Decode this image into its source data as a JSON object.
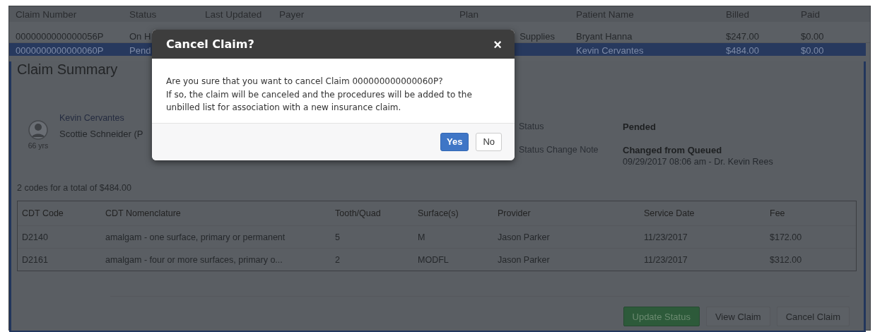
{
  "claims_table": {
    "columns": [
      {
        "label": "Claim Number"
      },
      {
        "label": "Status"
      },
      {
        "label": "Last Updated"
      },
      {
        "label": "Payer"
      },
      {
        "label": "Plan"
      },
      {
        "label": "Patient Name"
      },
      {
        "label": "Billed"
      },
      {
        "label": "Paid"
      }
    ],
    "rows": [
      {
        "claim_number": "0000000000000056P",
        "status": "On H",
        "plan": "Supplies",
        "patient_name": "Bryant Hanna",
        "billed": "$247.00",
        "paid": "$0.00",
        "selected": false
      },
      {
        "claim_number": "0000000000000060P",
        "status": "Pend",
        "patient_name": "Kevin Cervantes",
        "billed": "$484.00",
        "paid": "$0.00",
        "selected": true
      }
    ]
  },
  "claim_summary": {
    "title": "Claim Summary",
    "patient_name": "Kevin Cervantes",
    "subscriber": "Scottie Schneider (P",
    "age": "66 yrs",
    "fields": [
      {
        "label": "Status",
        "value": "Pended"
      },
      {
        "label": "Status Change Note",
        "value": "Changed from Queued",
        "detail": "09/29/2017 08:06 am - Dr. Kevin Rees"
      }
    ],
    "total": "2 codes for a total of $484.00",
    "procedures": {
      "columns": [
        "CDT Code",
        "CDT Nomenclature",
        "Tooth/Quad",
        "Surface(s)",
        "Provider",
        "Service Date",
        "Fee"
      ],
      "rows": [
        [
          "D2140",
          "amalgam - one surface, primary or permanent",
          "5",
          "M",
          "Jason Parker",
          "11/23/2017",
          "$172.00"
        ],
        [
          "D2161",
          "amalgam - four or more surfaces, primary o...",
          "2",
          "MODFL",
          "Jason Parker",
          "11/23/2017",
          "$312.00"
        ]
      ]
    },
    "actions": [
      {
        "label": "Update Status",
        "kind": "success"
      },
      {
        "label": "View Claim",
        "kind": "default"
      },
      {
        "label": "Cancel Claim",
        "kind": "default"
      }
    ]
  },
  "modal": {
    "title": "Cancel Claim?",
    "close": "×",
    "paragraphs": [
      "Are you sure that you want to cancel Claim 000000000000060P?",
      "If so, the claim will be canceled and the procedures will be added to the unbilled list for association with a new insurance claim."
    ],
    "buttons": [
      {
        "label": "Yes",
        "kind": "primary"
      },
      {
        "label": "No",
        "kind": "default"
      }
    ]
  }
}
